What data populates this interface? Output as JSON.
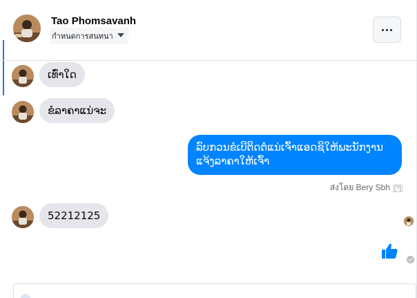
{
  "header": {
    "name": "Tao Phomsavanh",
    "status_label": "กำหนดการสนทนา"
  },
  "messages": [
    {
      "direction": "incoming",
      "text": "ເທົ່າໃດ"
    },
    {
      "direction": "incoming",
      "text": "ຂໍລາຄາແນ່ຈະ"
    },
    {
      "direction": "outgoing",
      "line1": "ລົບກວນຂໍເບີຕິດຕໍ່ແນ່ເຈົ້າແອດຊິໃຫ້ພະນັກງານ",
      "line2": "ແຈ້ງລາຄາໃຫ້ເຈົ້າ"
    },
    {
      "direction": "incoming",
      "text": "52212125"
    }
  ],
  "sent_by": {
    "label": "ส่งโดย Bery Sbh",
    "help": "[?]"
  },
  "colors": {
    "accent": "#0084ff",
    "incoming_bubble": "#e4e6eb",
    "like": "#0084ff"
  },
  "icons": {
    "more": "more-horizontal-icon",
    "like": "thumbs-up-icon",
    "sent": "check-circle-icon"
  }
}
